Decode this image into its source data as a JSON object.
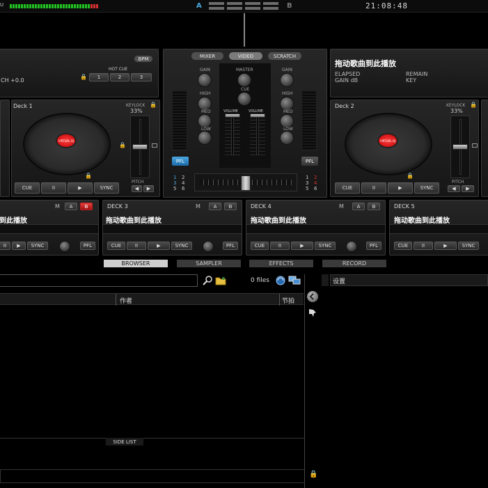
{
  "topbar": {
    "app_label": "U",
    "crossfader_a": "A",
    "crossfader_b": "B",
    "clock": "21:08:48"
  },
  "deck_left": {
    "pitch_text": "CH +0.0",
    "bpm_label": "BPM",
    "hot_cue_label": "HOT CUE",
    "hot_cues": [
      "1",
      "2",
      "3"
    ],
    "name": "Deck 1",
    "keylock_label": "KEYLOCK",
    "keylock_value": "33%",
    "pitch_label": "PITCH",
    "buttons": {
      "cue": "CUE",
      "pause": "II",
      "play": "▶",
      "sync": "SYNC"
    }
  },
  "mixer": {
    "tabs": [
      "MIXER",
      "VIDEO",
      "SCRATCH"
    ],
    "gain_left": "GAIN",
    "master": "MASTER",
    "gain_right": "GAIN",
    "high_left": "HIGH",
    "cue": "CUE",
    "high_right": "HIGH",
    "med_left": "MED",
    "volume_left": "VOLUME",
    "volume_right": "VOLUME",
    "med_right": "MED",
    "low_left": "LOW",
    "low_right": "LOW",
    "pfl_left": "PFL",
    "pfl_right": "PFL",
    "deck_nums_left": [
      "1",
      "2",
      "3",
      "4",
      "5",
      "6"
    ],
    "deck_nums_right": [
      "1",
      "2",
      "3",
      "4",
      "5",
      "6"
    ]
  },
  "deck_right": {
    "title": "拖动歌曲到此播放",
    "elapsed": "ELAPSED",
    "remain": "REMAIN",
    "gain_db": "GAIN dB",
    "key": "KEY",
    "name": "Deck 2",
    "keylock_label": "KEYLOCK",
    "keylock_value": "33%",
    "pitch_label": "PITCH",
    "buttons": {
      "cue": "CUE",
      "pause": "II",
      "play": "▶",
      "sync": "SYNC"
    }
  },
  "mini_decks": [
    {
      "name": "",
      "title": "到此播放",
      "m": "M",
      "a": "A",
      "b": "B",
      "sync": "SYNC",
      "pfl": "PFL"
    },
    {
      "name": "DECK 3",
      "title": "拖动歌曲到此播放",
      "m": "M",
      "a": "A",
      "b": "B",
      "cue": "CUE",
      "pause": "II",
      "play": "▶",
      "sync": "SYNC",
      "pfl": "PFL"
    },
    {
      "name": "DECK 4",
      "title": "拖动歌曲到此播放",
      "m": "M",
      "a": "A",
      "b": "B",
      "cue": "CUE",
      "pause": "II",
      "play": "▶",
      "sync": "SYNC",
      "pfl": "PFL"
    },
    {
      "name": "DECK 5",
      "title": "拖动歌曲到此播放",
      "cue": "CUE",
      "pause": "II",
      "play": "▶",
      "sync": "SYNC"
    }
  ],
  "bottom_tabs": [
    "BROWSER",
    "SAMPLER",
    "EFFECTS",
    "RECORD"
  ],
  "browser": {
    "search_placeholder": "",
    "file_count": "0 files",
    "columns": [
      "作者",
      "节拍"
    ],
    "side_list": "SIDE LIST",
    "settings_label": "设置"
  },
  "colors": {
    "accent_blue": "#1c6aa8",
    "red": "#d02020",
    "meter_green": "#22c422"
  }
}
